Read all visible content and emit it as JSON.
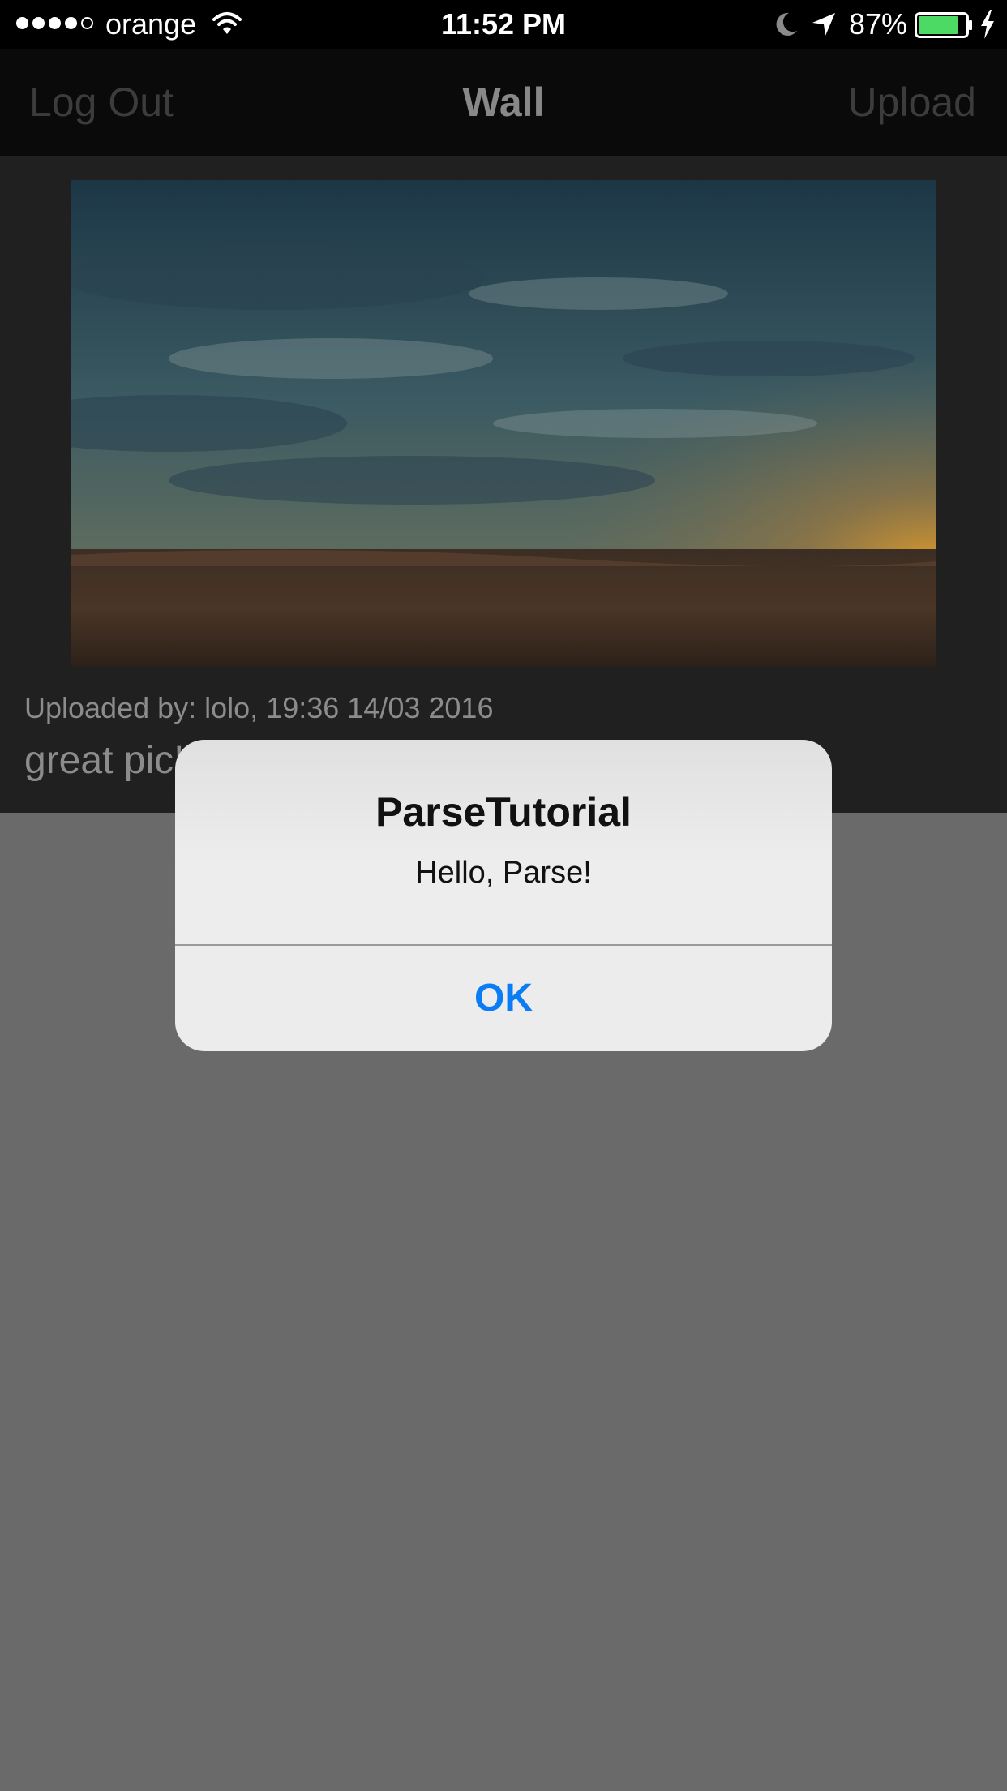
{
  "status_bar": {
    "carrier": "orange",
    "time": "11:52 PM",
    "battery_percent": "87%",
    "signal_bars_filled": 4,
    "signal_bars_total": 5,
    "battery_level": 0.87,
    "battery_color": "#4cd964",
    "icons": [
      "wifi-icon",
      "moon-icon",
      "location-arrow-icon",
      "battery-icon",
      "charging-bolt-icon"
    ]
  },
  "nav": {
    "left_button": "Log Out",
    "title": "Wall",
    "right_button": "Upload"
  },
  "post": {
    "uploaded_by": "Uploaded by: lolo, 19:36 14/03 2016",
    "caption": "great pic!"
  },
  "alert": {
    "title": "ParseTutorial",
    "message": "Hello, Parse!",
    "ok_label": "OK",
    "ok_color": "#0a7cf6"
  }
}
